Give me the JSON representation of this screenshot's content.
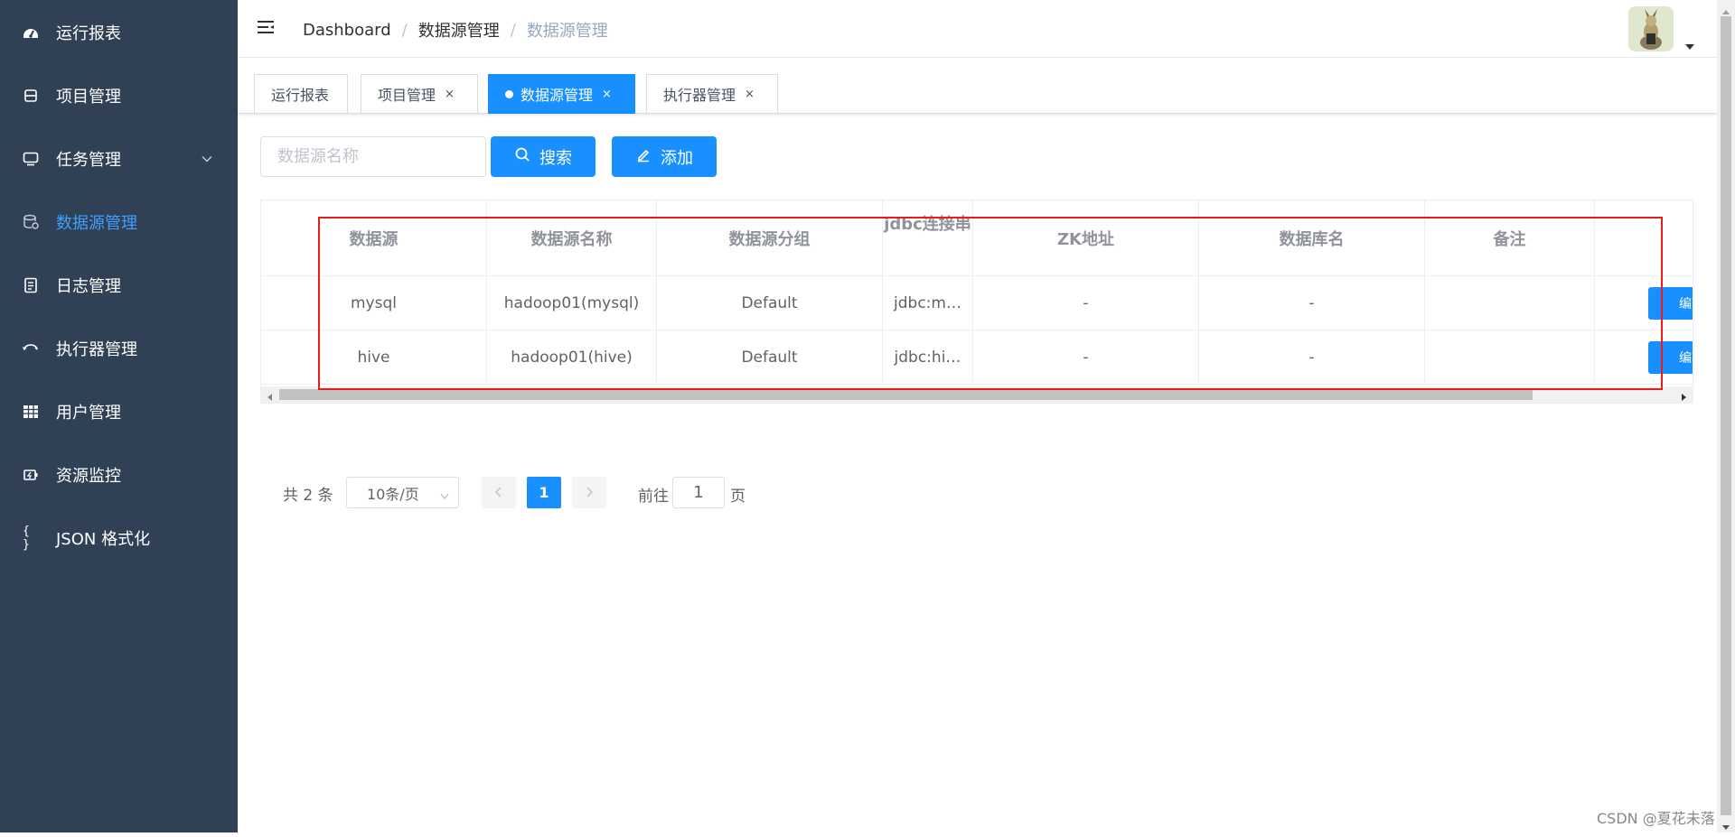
{
  "sidebar": {
    "items": [
      {
        "label": "运行报表",
        "icon": "dashboard-icon"
      },
      {
        "label": "项目管理",
        "icon": "project-icon"
      },
      {
        "label": "任务管理",
        "icon": "task-icon"
      },
      {
        "label": "数据源管理",
        "icon": "database-icon",
        "active": true
      },
      {
        "label": "日志管理",
        "icon": "log-icon"
      },
      {
        "label": "执行器管理",
        "icon": "executor-icon"
      },
      {
        "label": "用户管理",
        "icon": "user-icon"
      },
      {
        "label": "资源监控",
        "icon": "monitor-icon"
      },
      {
        "label": "JSON 格式化",
        "icon": "json-icon"
      }
    ]
  },
  "navbar": {
    "breadcrumb": [
      "Dashboard",
      "数据源管理",
      "数据源管理"
    ]
  },
  "tags": [
    {
      "label": "运行报表"
    },
    {
      "label": "项目管理",
      "close": "×"
    },
    {
      "label": "数据源管理",
      "close": "×",
      "active": true
    },
    {
      "label": "执行器管理",
      "close": "×"
    }
  ],
  "toolbar": {
    "search_placeholder": "数据源名称",
    "search_label": "搜索",
    "add_label": "添加"
  },
  "table": {
    "headers": [
      "数据源",
      "数据源名称",
      "数据源分组",
      "jdbc连接串",
      "ZK地址",
      "数据库名",
      "备注"
    ],
    "rows": [
      {
        "datasource": "mysql",
        "name": "hadoop01(mysql)",
        "group": "Default",
        "jdbc": "jdbc:m…",
        "zk": "-",
        "db": "-",
        "remark": "",
        "action": "编辑"
      },
      {
        "datasource": "hive",
        "name": "hadoop01(hive)",
        "group": "Default",
        "jdbc": "jdbc:hi…",
        "zk": "-",
        "db": "-",
        "remark": "",
        "action": "编辑"
      }
    ]
  },
  "pagination": {
    "total_text": "共 2 条",
    "page_size": "10条/页",
    "current_page": "1",
    "goto_label": "前往",
    "goto_value": "1",
    "page_unit": "页"
  },
  "watermark": "CSDN @夏花未落",
  "colors": {
    "sidebar_bg": "#304156",
    "accent": "#1890ff",
    "highlight": "#e81c1c"
  }
}
